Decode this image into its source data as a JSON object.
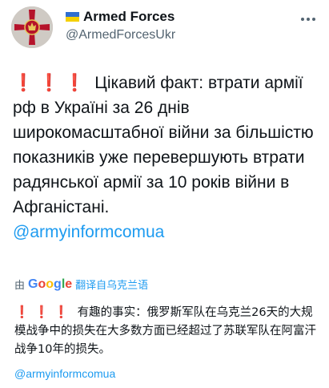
{
  "header": {
    "display_name": "Armed Forces",
    "handle": "@ArmedForcesUkr"
  },
  "tweet": {
    "exclamations": "❗❗❗",
    "text": "Цікавий факт: втрати армії рф в Україні за 26 днів широкомасштабної війни за більшістю показників уже перевершують втрати радянської армії за 10 років війни в Афганістані.",
    "mention": "@armyinformcomua"
  },
  "translation": {
    "by_label": "由",
    "provider": "Google",
    "link_text": "翻译自乌克兰语",
    "exclamations": "❗❗❗",
    "text": "有趣的事实：俄罗斯军队在乌克兰26天的大规模战争中的损失在大多数方面已经超过了苏联军队在阿富汗战争10年的损失。",
    "mention": "@armyinformcomua"
  },
  "colors": {
    "mention": "#1d9bf0",
    "exclamation": "#e0245e",
    "flag_blue": "#2f6fd1",
    "flag_yellow": "#f4d000"
  },
  "icons": {
    "avatar": "armed-forces-emblem",
    "flag": "ukraine-flag",
    "more": "more-options-icon"
  }
}
